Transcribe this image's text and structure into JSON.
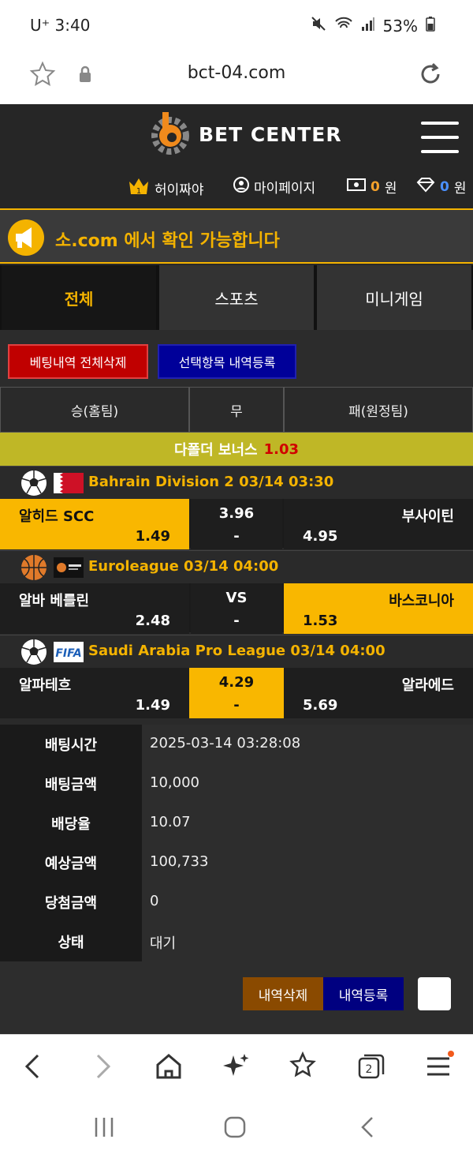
{
  "status_bar": {
    "time": "U⁺ 3:40",
    "battery": "53%"
  },
  "browser": {
    "url": "bct-04.com",
    "tab_count": "2"
  },
  "site": {
    "brand": "BET CENTER",
    "user_name": "허이짜야",
    "user_level": "1",
    "mypage": "마이페이지",
    "cash_value": "0",
    "cash_unit": "원",
    "point_value": "0",
    "point_unit": "원"
  },
  "notice": {
    "text": "소.com 에서 확인 가능합니다"
  },
  "tabs": [
    {
      "label": "전체",
      "active": true
    },
    {
      "label": "스포츠",
      "active": false
    },
    {
      "label": "미니게임",
      "active": false
    }
  ],
  "action_buttons": {
    "delete_all": "베팅내역 전체삭제",
    "register_selected": "선택항목 내역등록"
  },
  "columns": {
    "home": "승(홈팀)",
    "draw": "무",
    "away": "패(원정팀)"
  },
  "bonus": {
    "label": "다폴더 보너스",
    "value": "1.03"
  },
  "matches": [
    {
      "sport_icon": "soccer-ball-icon",
      "flag": "bahrain-flag",
      "league": "Bahrain Division 2 03/14 03:30",
      "home_team": "알히드 SCC",
      "home_odds": "1.49",
      "draw_top": "3.96",
      "draw_bottom": "-",
      "away_team": "부사이틴",
      "away_odds": "4.95",
      "selected": "home"
    },
    {
      "sport_icon": "basketball-icon",
      "flag": "euroleague-logo",
      "league": "Euroleague 03/14 04:00",
      "home_team": "알바 베를린",
      "home_odds": "2.48",
      "draw_top": "VS",
      "draw_bottom": "-",
      "away_team": "바스코니아",
      "away_odds": "1.53",
      "selected": "away"
    },
    {
      "sport_icon": "soccer-ball-icon",
      "flag": "fifa-logo",
      "flag_text": "FIFA",
      "league": "Saudi Arabia Pro League 03/14 04:00",
      "home_team": "알파테흐",
      "home_odds": "1.49",
      "draw_top": "4.29",
      "draw_bottom": "-",
      "away_team": "알라에드",
      "away_odds": "5.69",
      "selected": "draw"
    }
  ],
  "details": [
    {
      "label": "배팅시간",
      "value": "2025-03-14 03:28:08"
    },
    {
      "label": "배팅금액",
      "value": "10,000"
    },
    {
      "label": "배당율",
      "value": "10.07"
    },
    {
      "label": "예상금액",
      "value": "100,733"
    },
    {
      "label": "당첨금액",
      "value": "0"
    },
    {
      "label": "상태",
      "value": "대기"
    }
  ],
  "bottom_buttons": {
    "delete": "내역삭제",
    "register": "내역등록"
  },
  "colors": {
    "accent": "#f9b700",
    "background": "#2a2a2a",
    "delete_red": "#c00000",
    "register_blue": "#000099"
  }
}
